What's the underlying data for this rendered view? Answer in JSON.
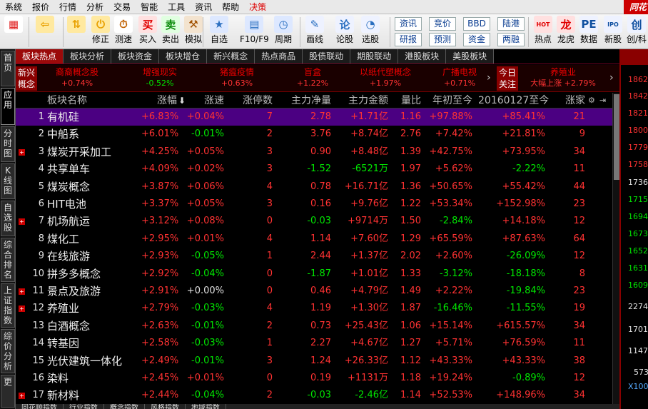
{
  "menu": [
    "系统",
    "报价",
    "行情",
    "分析",
    "交易",
    "智能",
    "工具",
    "资讯",
    "帮助",
    "决策"
  ],
  "brand": "同花",
  "toolbar": {
    "buttons": [
      {
        "label": "",
        "icon": "color-grid-icon"
      },
      {
        "label": "",
        "icon": "back-arrow-icon"
      },
      {
        "label": "修正",
        "icon": "up-down-arrows-icon"
      },
      {
        "label": "测速",
        "icon": "power-icon"
      },
      {
        "label": "买入",
        "icon": "clock-icon"
      },
      {
        "label": "卖出",
        "icon": "buy-icon"
      },
      {
        "label": "模拟",
        "icon": "sell-icon"
      },
      {
        "label": "自选",
        "icon": "gavel-icon"
      },
      {
        "label": "F10/F9",
        "icon": "star-list-icon"
      },
      {
        "label": "周期",
        "icon": "f10-icon"
      },
      {
        "label": "画线",
        "icon": "period-icon"
      },
      {
        "label": "论股",
        "icon": "pencil-icon"
      },
      {
        "label": "选股",
        "icon": "discuss-icon"
      },
      {
        "label": "热点",
        "icon": "select-stock-icon"
      },
      {
        "label": "龙虎",
        "icon": "hot-spot-icon"
      },
      {
        "label": "数据",
        "icon": "dragon-tiger-icon"
      },
      {
        "label": "新股",
        "icon": "data-icon"
      },
      {
        "label": "创/科",
        "icon": "new-stock-icon"
      }
    ],
    "icon_glyphs": [
      "▦",
      "⇦",
      "⇅",
      "⏻",
      "⏱",
      "买",
      "卖",
      "⚒",
      "★",
      "▤",
      "◷",
      "✎",
      "论",
      "◔",
      "HOT",
      "龙",
      "PE",
      "IPO",
      "创"
    ],
    "text_buttons": [
      {
        "top": "资讯",
        "bottom": "研报"
      },
      {
        "top": "竞价",
        "bottom": "预测"
      },
      {
        "top": "BBD",
        "bottom": "资金"
      },
      {
        "top": "陆港",
        "bottom": "两融"
      }
    ]
  },
  "left_tabs": [
    "首页",
    "应用",
    "分时图",
    "K线图",
    "自选股",
    "综合排名",
    "上证指数",
    "综价分析",
    "更"
  ],
  "sector_tabs": [
    "板块热点",
    "板块分析",
    "板块资金",
    "板块增仓",
    "新兴概念",
    "热点商品",
    "股债联动",
    "期股联动",
    "港股板块",
    "美股板块"
  ],
  "concept_label": "新兴概念",
  "concepts": [
    {
      "name": "裔裔概念股",
      "value": "+0.74%",
      "dir": "rise"
    },
    {
      "name": "增强现实",
      "value": "-0.52%",
      "dir": "fall"
    },
    {
      "name": "猪瘟疫情",
      "value": "+0.63%",
      "dir": "rise"
    },
    {
      "name": "盲盒",
      "value": "+1.22%",
      "dir": "rise"
    },
    {
      "name": "以纸代塑概念",
      "value": "+1.97%",
      "dir": "rise"
    },
    {
      "name": "广播电视",
      "value": "+0.71%",
      "dir": "rise"
    }
  ],
  "today_label": "今日关注",
  "today_item": {
    "name": "养殖业",
    "value": "大幅上涨 +2.79%"
  },
  "columns": [
    "",
    "板块名称",
    "涨幅",
    "涨速",
    "涨停数",
    "主力净量",
    "主力金额",
    "量比",
    "年初至今",
    "20160127至今",
    "涨家"
  ],
  "sort_icon": "down-arrow-icon",
  "rows": [
    {
      "no": "1",
      "name": "有机硅",
      "exp": false,
      "chg": "+6.83%",
      "speed": "+0.04%",
      "limit": "7",
      "net": "2.78",
      "amount": "+1.71亿",
      "vr": "1.16",
      "ytd": "+97.88%",
      "since": "+85.41%",
      "up": "21"
    },
    {
      "no": "2",
      "name": "中船系",
      "exp": false,
      "chg": "+6.01%",
      "speed": "-0.01%",
      "limit": "2",
      "net": "3.76",
      "amount": "+8.74亿",
      "vr": "2.76",
      "ytd": "+7.42%",
      "since": "+21.81%",
      "up": "9"
    },
    {
      "no": "3",
      "name": "煤炭开采加工",
      "exp": true,
      "chg": "+4.25%",
      "speed": "+0.05%",
      "limit": "3",
      "net": "0.90",
      "amount": "+8.48亿",
      "vr": "1.39",
      "ytd": "+42.75%",
      "since": "+73.95%",
      "up": "34"
    },
    {
      "no": "4",
      "name": "共享单车",
      "exp": false,
      "chg": "+4.09%",
      "speed": "+0.02%",
      "limit": "3",
      "net": "-1.52",
      "amount": "-6521万",
      "vr": "1.97",
      "ytd": "+5.62%",
      "since": "-2.22%",
      "up": "11"
    },
    {
      "no": "5",
      "name": "煤炭概念",
      "exp": false,
      "chg": "+3.87%",
      "speed": "+0.06%",
      "limit": "4",
      "net": "0.78",
      "amount": "+16.71亿",
      "vr": "1.36",
      "ytd": "+50.65%",
      "since": "+55.42%",
      "up": "44"
    },
    {
      "no": "6",
      "name": "HIT电池",
      "exp": false,
      "chg": "+3.37%",
      "speed": "+0.05%",
      "limit": "3",
      "net": "0.16",
      "amount": "+9.76亿",
      "vr": "1.22",
      "ytd": "+53.34%",
      "since": "+152.98%",
      "up": "23"
    },
    {
      "no": "7",
      "name": "机场航运",
      "exp": true,
      "chg": "+3.12%",
      "speed": "+0.08%",
      "limit": "0",
      "net": "-0.03",
      "amount": "+9714万",
      "vr": "1.50",
      "ytd": "-2.84%",
      "since": "+14.18%",
      "up": "12"
    },
    {
      "no": "8",
      "name": "煤化工",
      "exp": false,
      "chg": "+2.95%",
      "speed": "+0.01%",
      "limit": "4",
      "net": "1.14",
      "amount": "+7.60亿",
      "vr": "1.29",
      "ytd": "+65.59%",
      "since": "+87.63%",
      "up": "64"
    },
    {
      "no": "9",
      "name": "在线旅游",
      "exp": false,
      "chg": "+2.93%",
      "speed": "-0.05%",
      "limit": "1",
      "net": "2.44",
      "amount": "+1.37亿",
      "vr": "2.02",
      "ytd": "+2.60%",
      "since": "-26.09%",
      "up": "12"
    },
    {
      "no": "10",
      "name": "拼多多概念",
      "exp": false,
      "chg": "+2.92%",
      "speed": "-0.04%",
      "limit": "0",
      "net": "-1.87",
      "amount": "+1.01亿",
      "vr": "1.33",
      "ytd": "-3.12%",
      "since": "-18.18%",
      "up": "8"
    },
    {
      "no": "11",
      "name": "景点及旅游",
      "exp": true,
      "chg": "+2.91%",
      "speed": "+0.00%",
      "limit": "0",
      "net": "0.46",
      "amount": "+4.79亿",
      "vr": "1.49",
      "ytd": "+2.22%",
      "since": "-19.84%",
      "up": "23"
    },
    {
      "no": "12",
      "name": "养殖业",
      "exp": true,
      "chg": "+2.79%",
      "speed": "-0.03%",
      "limit": "4",
      "net": "1.19",
      "amount": "+1.30亿",
      "vr": "1.87",
      "ytd": "-16.46%",
      "since": "-11.55%",
      "up": "19"
    },
    {
      "no": "13",
      "name": "白酒概念",
      "exp": false,
      "chg": "+2.63%",
      "speed": "-0.01%",
      "limit": "2",
      "net": "0.73",
      "amount": "+25.43亿",
      "vr": "1.06",
      "ytd": "+15.14%",
      "since": "+615.57%",
      "up": "34"
    },
    {
      "no": "14",
      "name": "转基因",
      "exp": false,
      "chg": "+2.58%",
      "speed": "-0.03%",
      "limit": "1",
      "net": "2.27",
      "amount": "+4.67亿",
      "vr": "1.27",
      "ytd": "+5.71%",
      "since": "+76.59%",
      "up": "11"
    },
    {
      "no": "15",
      "name": "光伏建筑一体化",
      "exp": false,
      "chg": "+2.49%",
      "speed": "-0.01%",
      "limit": "3",
      "net": "1.24",
      "amount": "+26.33亿",
      "vr": "1.12",
      "ytd": "+43.33%",
      "since": "+43.33%",
      "up": "38"
    },
    {
      "no": "16",
      "name": "染料",
      "exp": false,
      "chg": "+2.45%",
      "speed": "+0.01%",
      "limit": "0",
      "net": "0.19",
      "amount": "+1131万",
      "vr": "1.18",
      "ytd": "+19.24%",
      "since": "-0.89%",
      "up": "12"
    },
    {
      "no": "17",
      "name": "新材料",
      "exp": true,
      "chg": "+2.44%",
      "speed": "-0.04%",
      "limit": "2",
      "net": "-0.03",
      "amount": "-2.46亿",
      "vr": "1.14",
      "ytd": "+52.53%",
      "since": "+148.96%",
      "up": "34"
    }
  ],
  "price_labels": [
    {
      "v": "1862",
      "c": "rise"
    },
    {
      "v": "1842",
      "c": "rise"
    },
    {
      "v": "1821",
      "c": "rise"
    },
    {
      "v": "1800",
      "c": "rise"
    },
    {
      "v": "1779",
      "c": "rise"
    },
    {
      "v": "1758",
      "c": "rise"
    },
    {
      "v": "1736",
      "c": "plain"
    },
    {
      "v": "1715",
      "c": "fall"
    },
    {
      "v": "1694",
      "c": "fall"
    },
    {
      "v": "1673",
      "c": "fall"
    },
    {
      "v": "1652",
      "c": "fall"
    },
    {
      "v": "1631",
      "c": "fall"
    },
    {
      "v": "1609",
      "c": "fall"
    },
    {
      "v": "2274",
      "c": "plain"
    },
    {
      "v": "1701",
      "c": "plain"
    },
    {
      "v": "1147",
      "c": "plain"
    },
    {
      "v": "573",
      "c": "plain"
    },
    {
      "v": "X100",
      "c": "plain"
    }
  ],
  "bottom_tabs": [
    "同花顺指数",
    "行业指数",
    "概念指数",
    "风格指数",
    "地域指数"
  ],
  "colors": {
    "rise": "#ff3232",
    "fall": "#00e600",
    "selected_row": "#4b0082",
    "accent": "#9b0a0a"
  }
}
